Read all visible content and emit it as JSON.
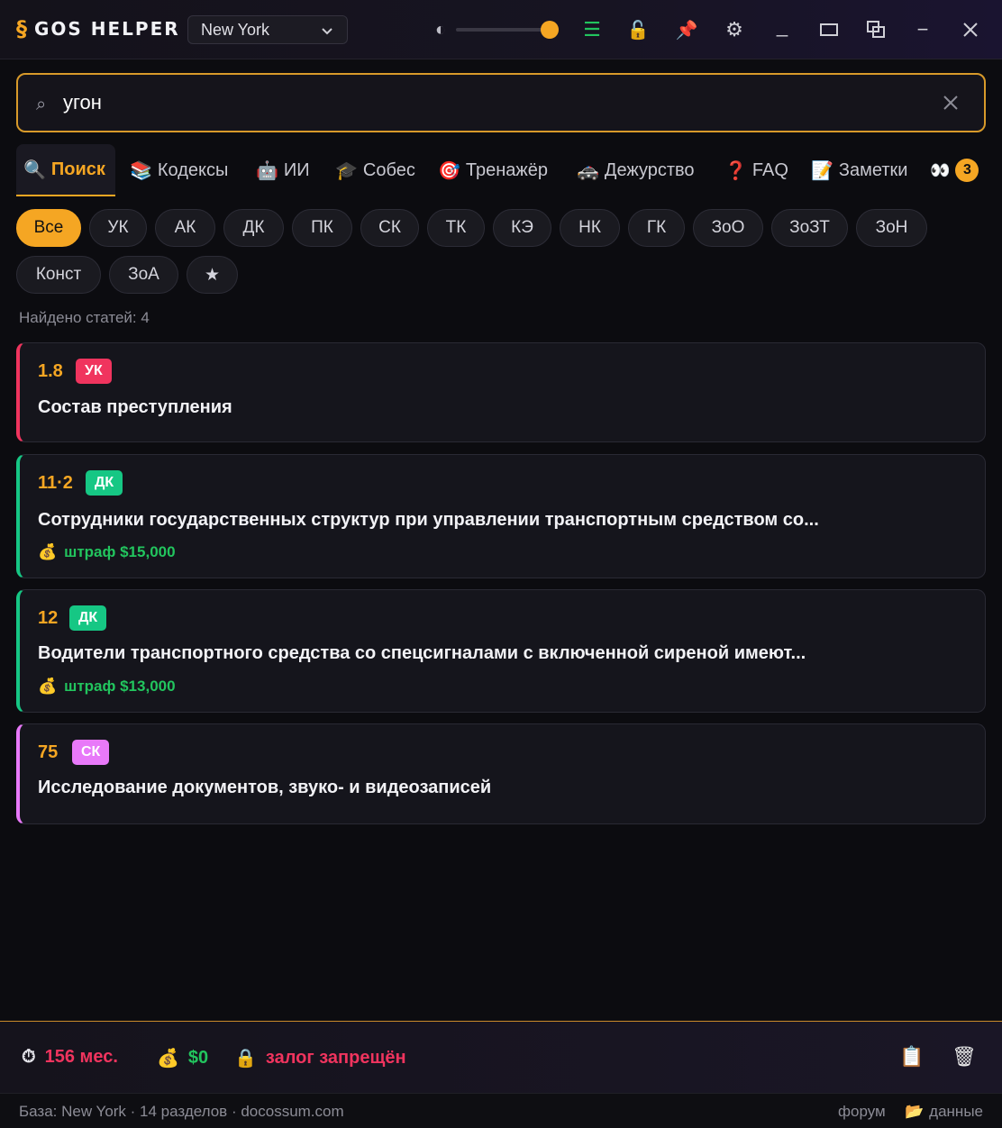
{
  "app": {
    "logo_mark": "§",
    "title": "GOS HELPER",
    "city": "New York"
  },
  "titlebar": {
    "contrast_icon": "◐",
    "slider_value": 1.0,
    "menu_icon": "☰",
    "lock_icon": "🔓",
    "pin_icon": "📌",
    "gear_icon": "⚙",
    "minimize_label": "_",
    "window_icon": "▭",
    "restore_icon": "⧉",
    "dash_label": "−"
  },
  "search": {
    "value": "угон",
    "icon": "⌕"
  },
  "tabs": [
    {
      "icon": "🔍",
      "label": "Поиск"
    },
    {
      "icon": "📚",
      "label": "Кодексы"
    },
    {
      "icon": "🤖",
      "label": "ИИ"
    },
    {
      "icon": "🎓",
      "label": "Собес"
    },
    {
      "icon": "🎯",
      "label": "Тренажёр"
    },
    {
      "icon": "🚓",
      "label": "Дежурство"
    },
    {
      "icon": "❓",
      "label": "FAQ"
    },
    {
      "icon": "📝",
      "label": "Заметки"
    },
    {
      "icon": "👀",
      "badge": "3"
    }
  ],
  "chips": [
    "Все",
    "УК",
    "АК",
    "ДК",
    "ПК",
    "СК",
    "ТК",
    "КЭ",
    "НК",
    "ГК",
    "ЗоО",
    "ЗоЗТ",
    "ЗоН",
    "Конст",
    "ЗоА",
    "★"
  ],
  "found": "Найдено статей: 4",
  "results": [
    {
      "num": "1.8",
      "code": "УК",
      "title": "Состав преступления",
      "fine": ""
    },
    {
      "num": "11·2",
      "code": "ДК",
      "title": "Сотрудники государственных структур при управлении транспортным средством со...",
      "fine": "штраф $15,000"
    },
    {
      "num": "12",
      "code": "ДК",
      "title": "Водители транспортного средства со спецсигналами с включенной сиреной имеют...",
      "fine": "штраф $13,000"
    },
    {
      "num": "75",
      "code": "СК",
      "title": "Исследование документов, звуко- и видеозаписей",
      "fine": ""
    }
  ],
  "bottom": {
    "term": "156 мес.",
    "money": "$0",
    "bail": "залог запрещён",
    "term_icon": "⏱",
    "money_icon": "💰",
    "bail_icon": "🔒",
    "clipboard_icon": "📋",
    "trash_icon": "🗑"
  },
  "footer": {
    "left": "База: New York · 14 разделов · docossum.com",
    "forum": "форум",
    "data_icon": "📂",
    "data": "данные"
  },
  "colors": {
    "accent": "#f5a623",
    "uk": "#f0345e",
    "dk": "#16c784",
    "sk": "#e879f9",
    "fine": "#22c55e",
    "danger": "#f0345e"
  }
}
